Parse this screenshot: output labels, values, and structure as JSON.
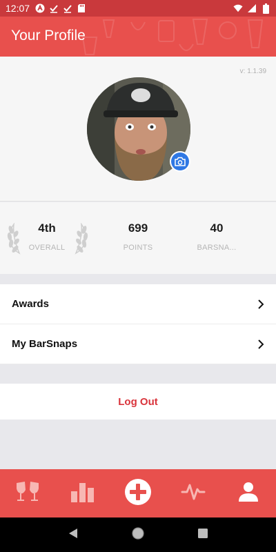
{
  "status_bar": {
    "time": "12:07",
    "left_icons": [
      "android-icon",
      "check-icon",
      "check-icon",
      "sd-card-icon"
    ],
    "right_icons": [
      "wifi-icon",
      "signal-icon",
      "battery-icon"
    ]
  },
  "app_bar": {
    "title": "Your Profile"
  },
  "profile": {
    "version": "v: 1.1.39",
    "avatar_icon": "profile-photo",
    "camera_icon": "camera-icon"
  },
  "stats": {
    "overall": {
      "value": "4th",
      "label": "OVERALL"
    },
    "points": {
      "value": "699",
      "label": "POINTS"
    },
    "barsnaps": {
      "value": "40",
      "label": "BARSNA..."
    }
  },
  "menu": {
    "items": [
      {
        "label": "Awards"
      },
      {
        "label": "My BarSnaps"
      }
    ]
  },
  "logout": {
    "label": "Log Out"
  },
  "bottom_nav": {
    "items": [
      "cheers-icon",
      "bar-chart-icon",
      "add-icon",
      "activity-icon",
      "profile-icon"
    ]
  },
  "colors": {
    "status_bar": "#c9393c",
    "primary": "#e8504d",
    "logout_text": "#d9333b",
    "camera_badge": "#2f78e4"
  }
}
